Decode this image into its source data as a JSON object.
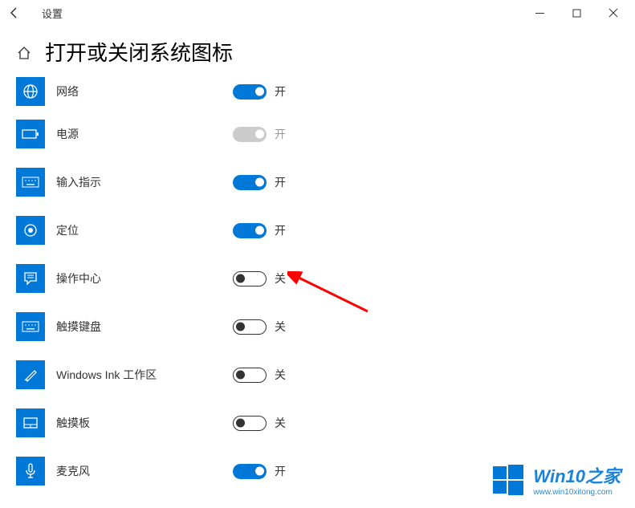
{
  "app_title": "设置",
  "page_title": "打开或关闭系统图标",
  "toggle_on_text": "开",
  "toggle_off_text": "关",
  "items": [
    {
      "label": "网络",
      "state": "on",
      "icon": "globe"
    },
    {
      "label": "电源",
      "state": "disabled",
      "icon": "battery"
    },
    {
      "label": "输入指示",
      "state": "on",
      "icon": "keyboard"
    },
    {
      "label": "定位",
      "state": "on",
      "icon": "location"
    },
    {
      "label": "操作中心",
      "state": "off",
      "icon": "action-center"
    },
    {
      "label": "触摸键盘",
      "state": "off",
      "icon": "keyboard"
    },
    {
      "label": "Windows Ink 工作区",
      "state": "off",
      "icon": "ink"
    },
    {
      "label": "触摸板",
      "state": "off",
      "icon": "touchpad"
    },
    {
      "label": "麦克风",
      "state": "on",
      "icon": "microphone"
    }
  ],
  "watermark": {
    "brand": "Win10之家",
    "url": "www.win10xitong.com"
  }
}
